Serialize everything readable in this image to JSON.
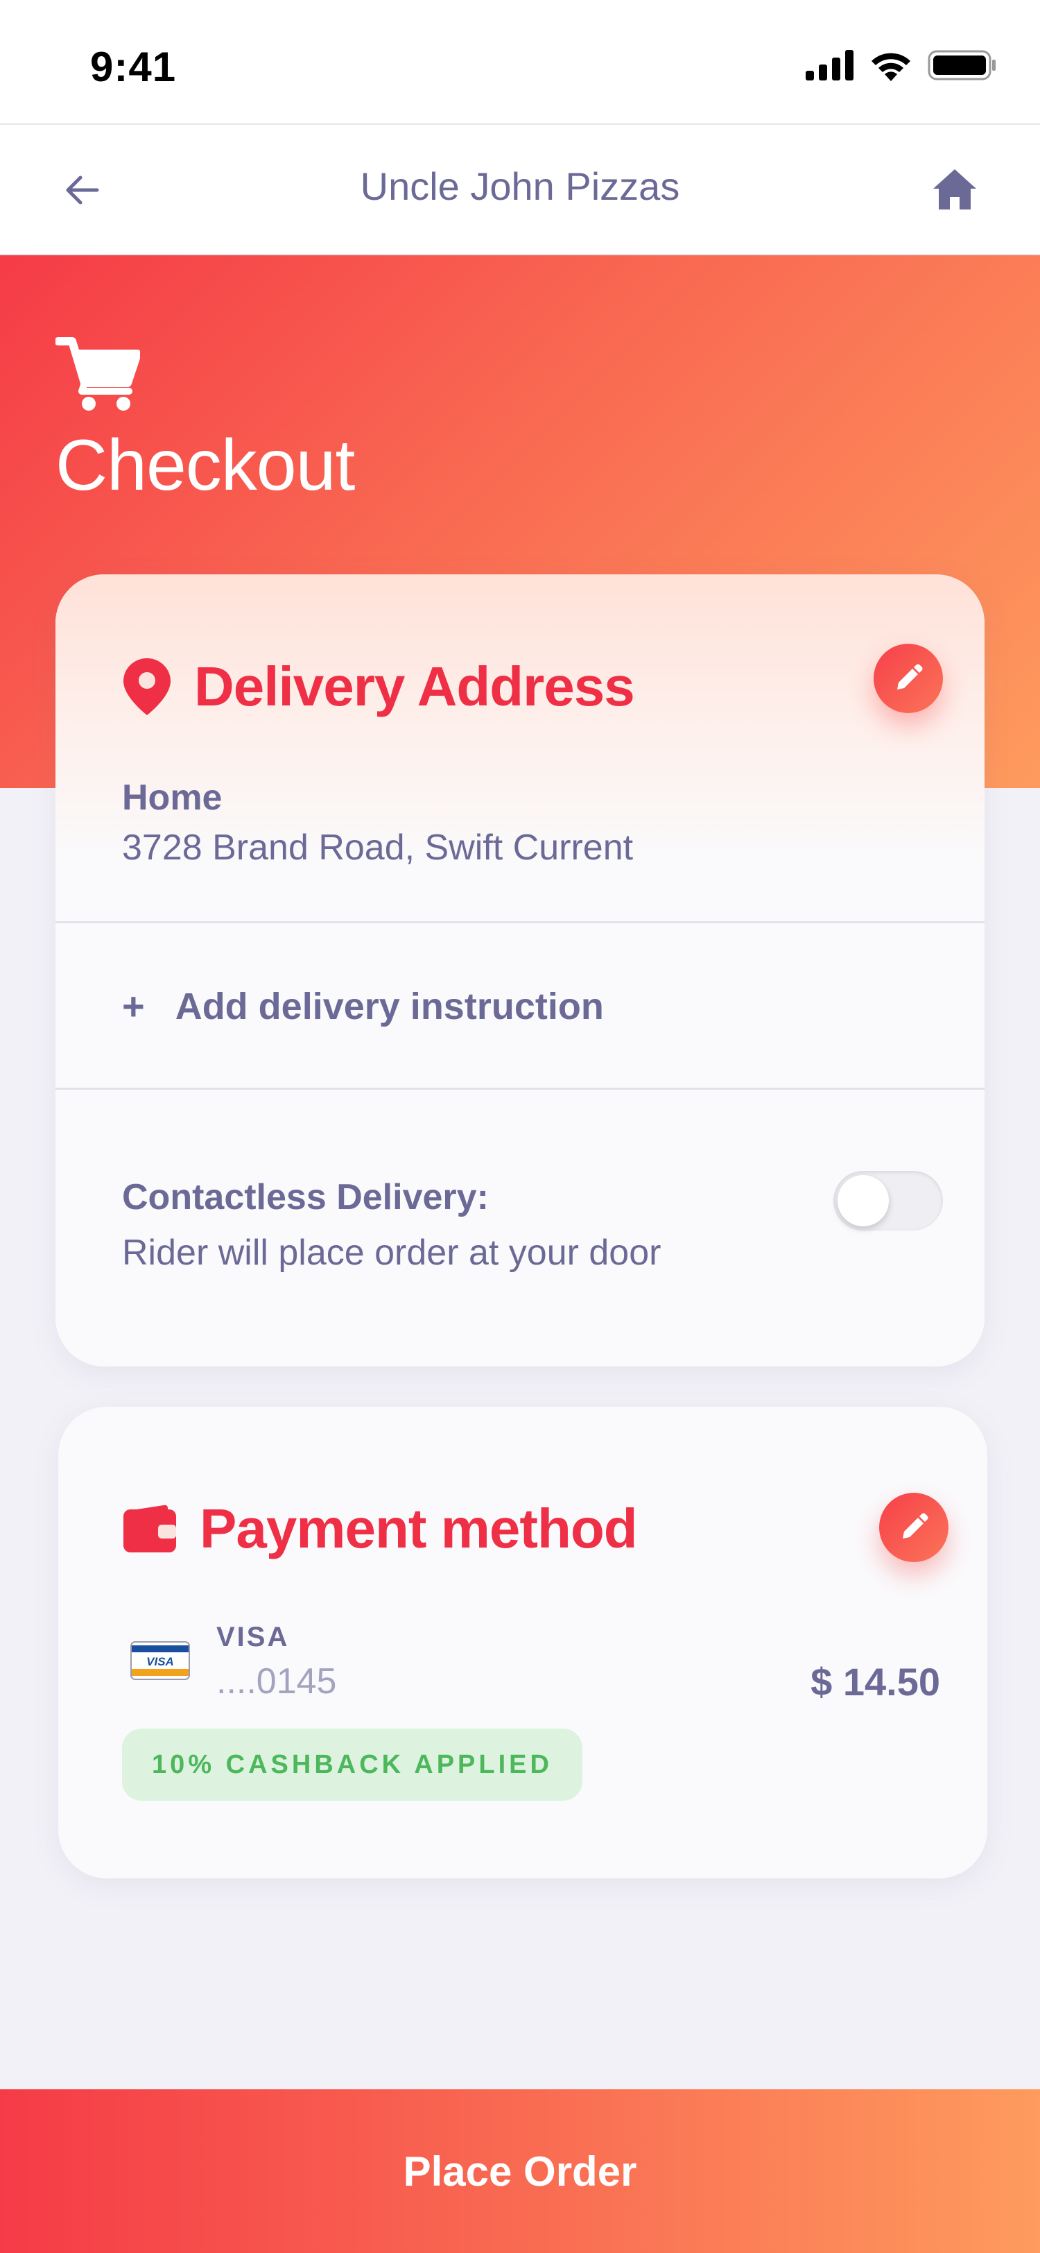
{
  "status_bar": {
    "time": "9:41"
  },
  "header": {
    "title": "Uncle John Pizzas"
  },
  "page": {
    "title": "Checkout"
  },
  "delivery": {
    "title": "Delivery Address",
    "address_label": "Home",
    "address_line": "3728  Brand Road, Swift Current",
    "add_instruction_plus": "+",
    "add_instruction_label": "Add delivery instruction",
    "contactless_label": "Contactless Delivery:",
    "contactless_sub": "Rider will place order at your door",
    "contactless_enabled": false
  },
  "payment": {
    "title": "Payment method",
    "card_brand": "VISA",
    "card_logo_text": "VISA",
    "card_number": "....0145",
    "amount": "$ 14.50",
    "cashback": "10% CASHBACK APPLIED"
  },
  "footer": {
    "place_order_label": "Place Order"
  },
  "colors": {
    "accent": "#EE2F45",
    "gradient_start": "#F53B47",
    "gradient_end": "#FE9B5E",
    "text": "#6B6996",
    "cashback_text": "#4CB75B",
    "cashback_bg": "#DDF3DF"
  },
  "icons": {
    "back": "arrow-left-icon",
    "home": "home-icon",
    "cart": "shopping-cart-icon",
    "location": "map-pin-icon",
    "edit": "pencil-icon",
    "wallet": "wallet-icon",
    "visa": "visa-card-icon",
    "signal": "signal-icon",
    "wifi": "wifi-icon",
    "battery": "battery-icon"
  }
}
